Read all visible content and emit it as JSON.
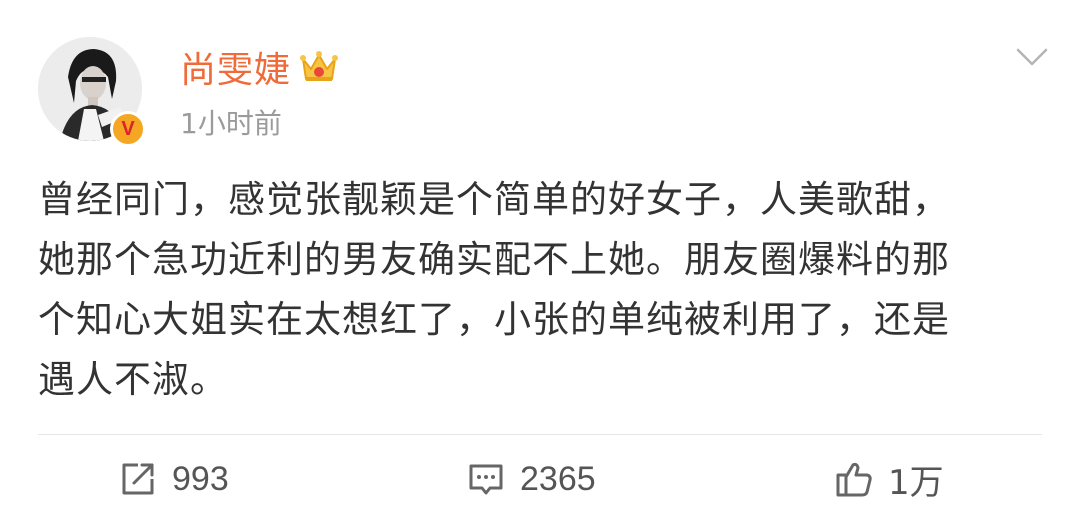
{
  "user": {
    "name": "尚雯婕",
    "timestamp": "1小时前",
    "verified_label": "V"
  },
  "post": {
    "text": "曾经同门，感觉张靓颖是个简单的好女子，人美歌甜，\n她那个急功近利的男友确实配不上她。朋友圈爆料的那\n个知心大姐实在太想红了，小张的单纯被利用了，还是\n遇人不淑。"
  },
  "actions": {
    "repost_count": "993",
    "comment_count": "2365",
    "like_count": "1万"
  },
  "colors": {
    "username": "#f06b3a",
    "timestamp": "#9b9b9b",
    "text": "#333333",
    "badge": "#f5a623",
    "icon": "#666666"
  },
  "icons": {
    "crown": "crown-icon",
    "menu": "chevron-down-icon",
    "repost": "repost-icon",
    "comment": "comment-icon",
    "like": "thumbs-up-icon"
  }
}
